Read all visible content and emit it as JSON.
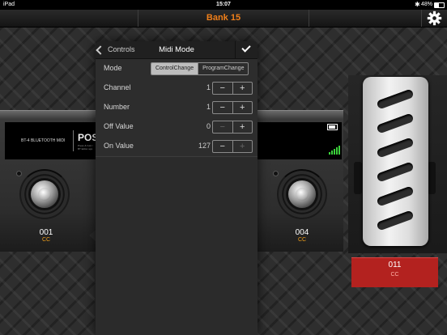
{
  "status": {
    "device": "iPad",
    "time": "15:07",
    "battery": "48%"
  },
  "header": {
    "title": "Bank 15",
    "settings_icon": "gear-icon"
  },
  "display": {
    "left_text": "BT-4 BLUETOOTH MIDI",
    "brand": "POS",
    "sub_text": "Press & hold / BT Editor app"
  },
  "footswitches": [
    {
      "number": "001",
      "type": "CC"
    },
    {
      "number": "004",
      "type": "CC"
    }
  ],
  "expression": {
    "number": "011",
    "type": "CC"
  },
  "popover": {
    "back_label": "Controls",
    "title": "Midi Mode",
    "mode": {
      "label": "Mode",
      "options": [
        "ControlChange",
        "ProgramChange"
      ],
      "selected": "ControlChange"
    },
    "rows": [
      {
        "label": "Channel",
        "value": "1"
      },
      {
        "label": "Number",
        "value": "1"
      },
      {
        "label": "Off Value",
        "value": "0"
      },
      {
        "label": "On Value",
        "value": "127"
      }
    ],
    "minus": "−",
    "plus": "+"
  }
}
